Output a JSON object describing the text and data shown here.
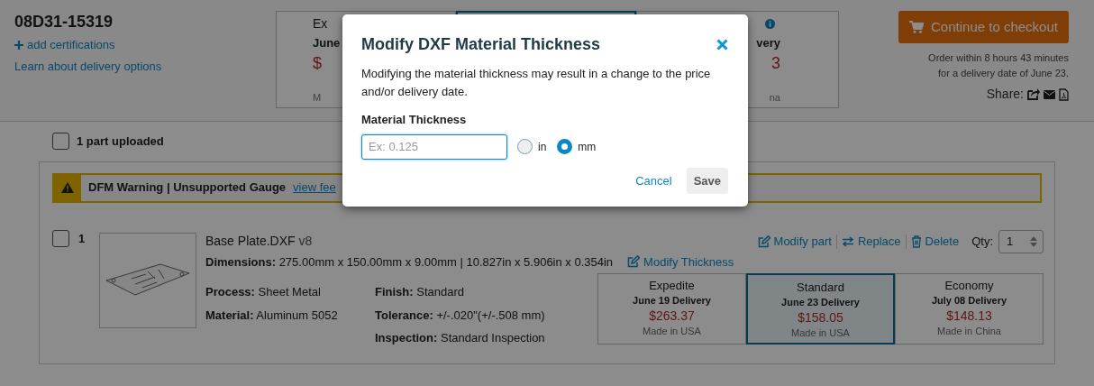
{
  "header": {
    "order_id": "08D31-15319",
    "add_certifications": "add certifications",
    "learn_link": "Learn about delivery options"
  },
  "top_delivery_options": [
    {
      "label": "Ex",
      "date": "June",
      "price": "$",
      "origin": "M",
      "selected": false,
      "info": false
    },
    {
      "selected": true,
      "info": false
    },
    {
      "date": "very",
      "price": "3",
      "origin": "na",
      "selected": false,
      "info": true
    }
  ],
  "checkout": {
    "label": "Continue to checkout",
    "note": [
      "Order within 8 hours 43 minutes",
      "for a delivery date of June 23."
    ],
    "share_label": "Share:"
  },
  "parts_header": {
    "checked": false,
    "label": "1 part uploaded"
  },
  "warning": {
    "title": "DFM Warning | Unsupported Gauge",
    "link": "view fee"
  },
  "part": {
    "checked": false,
    "number": "1",
    "name": "Base Plate.DXF",
    "version": "v8",
    "dimensions_label": "Dimensions:",
    "dimensions": "275.00mm x 150.00mm x 9.00mm | 10.827in x 5.906in x 0.354in",
    "modify_thickness": "Modify Thickness",
    "actions": [
      {
        "kind": "edit",
        "label": "Modify part"
      },
      {
        "kind": "swap",
        "label": "Replace"
      },
      {
        "kind": "trash",
        "label": "Delete"
      }
    ],
    "qty_label": "Qty:",
    "qty": "1",
    "spec_columns": [
      [
        {
          "label": "Process:",
          "value": "Sheet Metal"
        },
        {
          "label": "Material:",
          "value": "Aluminum 5052"
        }
      ],
      [
        {
          "label": "Finish:",
          "value": "Standard"
        },
        {
          "label": "Tolerance:",
          "value": "+/-.020\"(+/-.508 mm)"
        },
        {
          "label": "Inspection:",
          "value": "Standard Inspection"
        }
      ]
    ],
    "delivery_options": [
      {
        "label": "Expedite",
        "date": "June 19 Delivery",
        "price": "$263.37",
        "origin": "Made in USA",
        "selected": false
      },
      {
        "label": "Standard",
        "date": "June 23 Delivery",
        "price": "$158.05",
        "origin": "Made in USA",
        "selected": true
      },
      {
        "label": "Economy",
        "date": "July 08 Delivery",
        "price": "$148.13",
        "origin": "Made in China",
        "selected": false
      }
    ]
  },
  "modal": {
    "title": "Modify DXF Material Thickness",
    "message": "Modifying the material thickness may result in a change to the price and/or delivery date.",
    "field_label": "Material Thickness",
    "placeholder": "Ex: 0.125",
    "units": [
      {
        "label": "in",
        "selected": false
      },
      {
        "label": "mm",
        "selected": true
      }
    ],
    "cancel": "Cancel",
    "save": "Save"
  }
}
